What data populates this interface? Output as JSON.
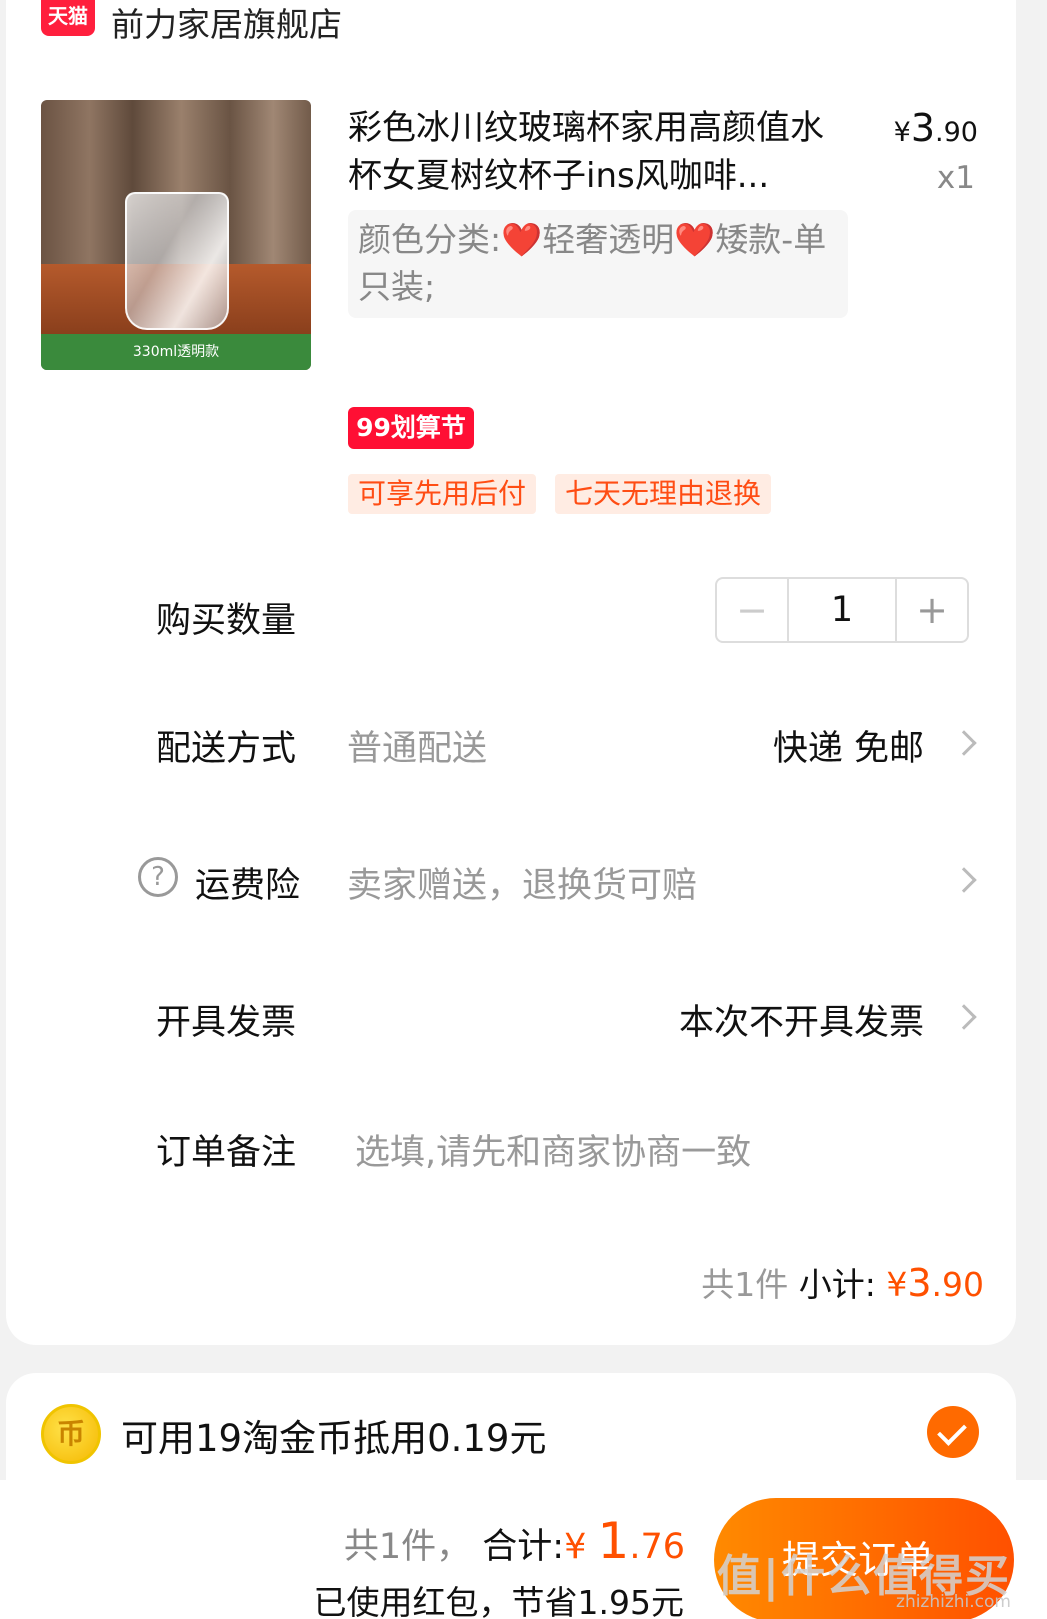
{
  "store": {
    "logo_text": "天猫",
    "name": "前力家居旗舰店"
  },
  "product": {
    "thumb_caption": "330ml透明款",
    "title": "彩色冰川纹玻璃杯家用高颜值水杯女夏树纹杯子ins风咖啡...",
    "price_currency": "¥",
    "price_int": "3",
    "price_dec": ".90",
    "quantity_text": "x1",
    "sku": "颜色分类:❤️轻奢透明❤️矮款-单只装;",
    "promo_badge": "99划算节",
    "tags": [
      "可享先用后付",
      "七天无理由退换"
    ]
  },
  "rows": {
    "quantity": {
      "label": "购买数量",
      "minus": "−",
      "value": "1",
      "plus": "+"
    },
    "delivery": {
      "label": "配送方式",
      "sub": "普通配送",
      "value": "快递 免邮"
    },
    "insurance": {
      "icon": "?",
      "label": "运费险",
      "sub": "卖家赠送，退换货可赔"
    },
    "invoice": {
      "label": "开具发票",
      "value": "本次不开具发票"
    },
    "note": {
      "label": "订单备注",
      "placeholder": "选填,请先和商家协商一致"
    }
  },
  "subtotal": {
    "count": "共1件",
    "label": "小计:",
    "currency": "¥",
    "int": "3",
    "dec": ".90"
  },
  "coins": {
    "icon": "币",
    "text": "可用19淘金币抵用0.19元",
    "checked": true
  },
  "footer": {
    "count": "共1件，",
    "total_label": "合计:",
    "currency": "¥",
    "total_int": "1",
    "total_dec": ".76",
    "saved": "已使用红包，节省1.95元",
    "submit": "提交订单"
  },
  "watermark": {
    "text": "值|什么值得买",
    "url": "zhizhizhi.com"
  },
  "colors": {
    "accent": "#ff5000",
    "tmall_red": "#ff1f3d",
    "tag_bg": "#ffece3",
    "tag_text": "#ff4d14"
  }
}
